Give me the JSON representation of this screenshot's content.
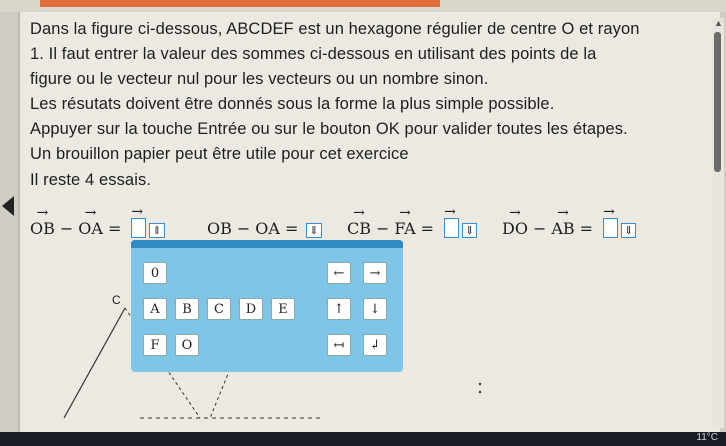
{
  "instructions": [
    "Dans la figure ci-dessous, ABCDEF est un hexagone régulier de centre O et rayon",
    "1. Il faut entrer la valeur des sommes ci-dessous en utilisant des points de la",
    "figure ou le vecteur nul pour les vecteurs ou un nombre sinon.",
    "Les résutats doivent être donnés sous la forme la plus simple possible.",
    "Appuyer sur la touche Entrée ou sur le bouton OK pour valider toutes les étapes.",
    "Un brouillon papier peut être utile pour cet exercice",
    "Il reste 4 essais."
  ],
  "equations": [
    {
      "a": "OB",
      "op": "−",
      "b": "OA",
      "eq": "=",
      "vector": true,
      "value": ""
    },
    {
      "a": "OB",
      "op": "−",
      "b": "OA",
      "eq": "=",
      "vector": false,
      "value": ""
    },
    {
      "a": "CB",
      "op": "−",
      "b": "FA",
      "eq": "=",
      "vector": true,
      "value": ""
    },
    {
      "a": "DO",
      "op": "−",
      "b": "AB",
      "eq": "=",
      "vector": true,
      "value": ""
    }
  ],
  "keypad": {
    "row0": [
      "0",
      "←",
      "→"
    ],
    "row1": [
      "A",
      "B",
      "C",
      "D",
      "E",
      "↑",
      "↓"
    ],
    "row2": [
      "F",
      "O",
      "↤",
      "↲"
    ]
  },
  "figure": {
    "label_c": "C"
  },
  "taskbar": {
    "temperature": "11°C"
  },
  "colors": {
    "keypad_bg": "#7ec5e8",
    "keypad_header": "#2f8bc0",
    "input_border": "#3a8fd0",
    "top_accent": "#e36d3b"
  }
}
